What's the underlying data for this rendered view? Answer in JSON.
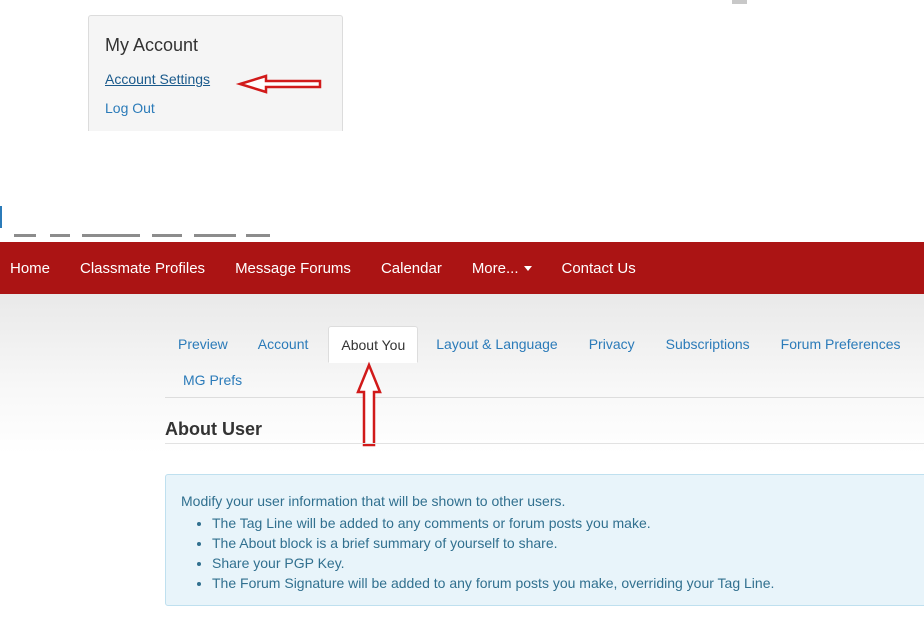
{
  "account_panel": {
    "title": "My Account",
    "links": {
      "settings": "Account Settings",
      "logout": "Log Out"
    }
  },
  "navbar": {
    "items": [
      "Home",
      "Classmate Profiles",
      "Message Forums",
      "Calendar",
      "More...",
      "Contact Us"
    ]
  },
  "tabs": {
    "row1": [
      "Preview",
      "Account",
      "About You",
      "Layout & Language",
      "Privacy",
      "Subscriptions",
      "Forum Preferences"
    ],
    "row2": [
      "MG Prefs"
    ],
    "active": "About You"
  },
  "section": {
    "title": "About User"
  },
  "info": {
    "intro": "Modify your user information that will be shown to other users.",
    "bullets": [
      "The Tag Line will be added to any comments or forum posts you make.",
      "The About block is a brief summary of yourself to share.",
      "Share your PGP Key.",
      "The Forum Signature will be added to any forum posts you make, overriding your Tag Line."
    ]
  },
  "colors": {
    "navbar_bg": "#ab1414",
    "link": "#2b7bb9",
    "info_bg": "#e8f4fa",
    "info_text": "#31708f",
    "annotation_arrow": "#d11a1a"
  },
  "icons": {
    "dropdown_caret": "chevron-down-icon",
    "left_arrow": "red-left-arrow-annotation",
    "up_arrow": "red-up-arrow-annotation"
  }
}
